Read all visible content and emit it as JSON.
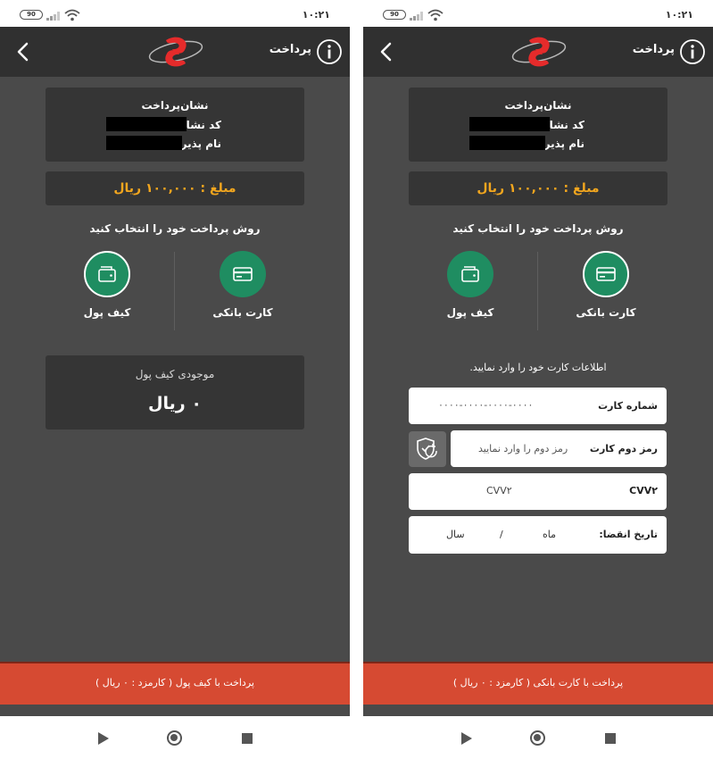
{
  "status_bar": {
    "battery": "90",
    "time": "۱۰:۲۱"
  },
  "app_bar": {
    "title": "پرداخت"
  },
  "payment_info": {
    "title": "نشان‌پرداخت",
    "code_label": "کد نشان‌پرداخت:",
    "merchant_label": "نام پذیرنده:"
  },
  "amount": "مبلغ : ۱۰۰,۰۰۰ ریال",
  "method_prompt": "روش پرداخت خود را انتخاب کنید",
  "methods": {
    "bank_card": "کارت بانکی",
    "wallet": "کیف پول"
  },
  "left_screen": {
    "selected_method": "wallet",
    "wallet_balance_title": "موجودی کیف پول",
    "wallet_balance": "۰ ریال",
    "pay_button": "پرداخت با کیف پول ( کارمزد : ۰ ریال )"
  },
  "right_screen": {
    "selected_method": "bank_card",
    "card_prompt": "اطلاعات کارت خود را وارد نمایید.",
    "card_number_label": "شماره کارت",
    "card_number_placeholder": "۰۰۰۰-۰۰۰۰-۰۰۰۰-۰۰۰۰",
    "otp_label": "رمز دوم کارت",
    "otp_placeholder": "رمز دوم را وارد نمایید",
    "cvv2_label": "CVV۲",
    "cvv2_placeholder": "CVV۲",
    "expiry_label": "تاریخ انقضا:",
    "expiry_month": "ماه",
    "expiry_separator": "/",
    "expiry_year": "سال",
    "pay_button": "پرداخت با کارت بانکی ( کارمزد : ۰ ریال )"
  },
  "colors": {
    "accent_green": "#1f8d61",
    "amount_orange": "#f2a61e",
    "pay_red": "#d64a32",
    "background": "#4a4a4a",
    "card": "#353535"
  }
}
